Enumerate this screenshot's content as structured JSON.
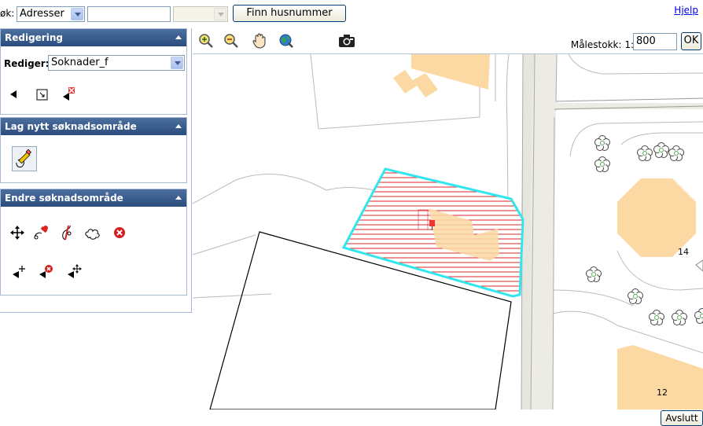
{
  "search": {
    "label": "øk:",
    "type_value": "Adresser",
    "text_value": "",
    "third_value": "",
    "button_label": "Finn husnummer"
  },
  "help_link": "Hjelp",
  "panels": {
    "redigering": {
      "title": "Redigering",
      "rediger_label": "Rediger:",
      "layer_value": "Soknader_f"
    },
    "lag_nytt": {
      "title": "Lag nytt søknadsområde"
    },
    "endre": {
      "title": "Endre søknadsområde"
    }
  },
  "scale": {
    "label": "Målestokk: 1:",
    "value": "800",
    "ok_label": "OK"
  },
  "map": {
    "labels": [
      "14",
      "12"
    ]
  },
  "exit_button": "Avslutt",
  "colors": {
    "header": "#2b4d7e",
    "building": "#fcd9a3",
    "selection": "#33e6ee",
    "hatch": "#d9282a"
  }
}
